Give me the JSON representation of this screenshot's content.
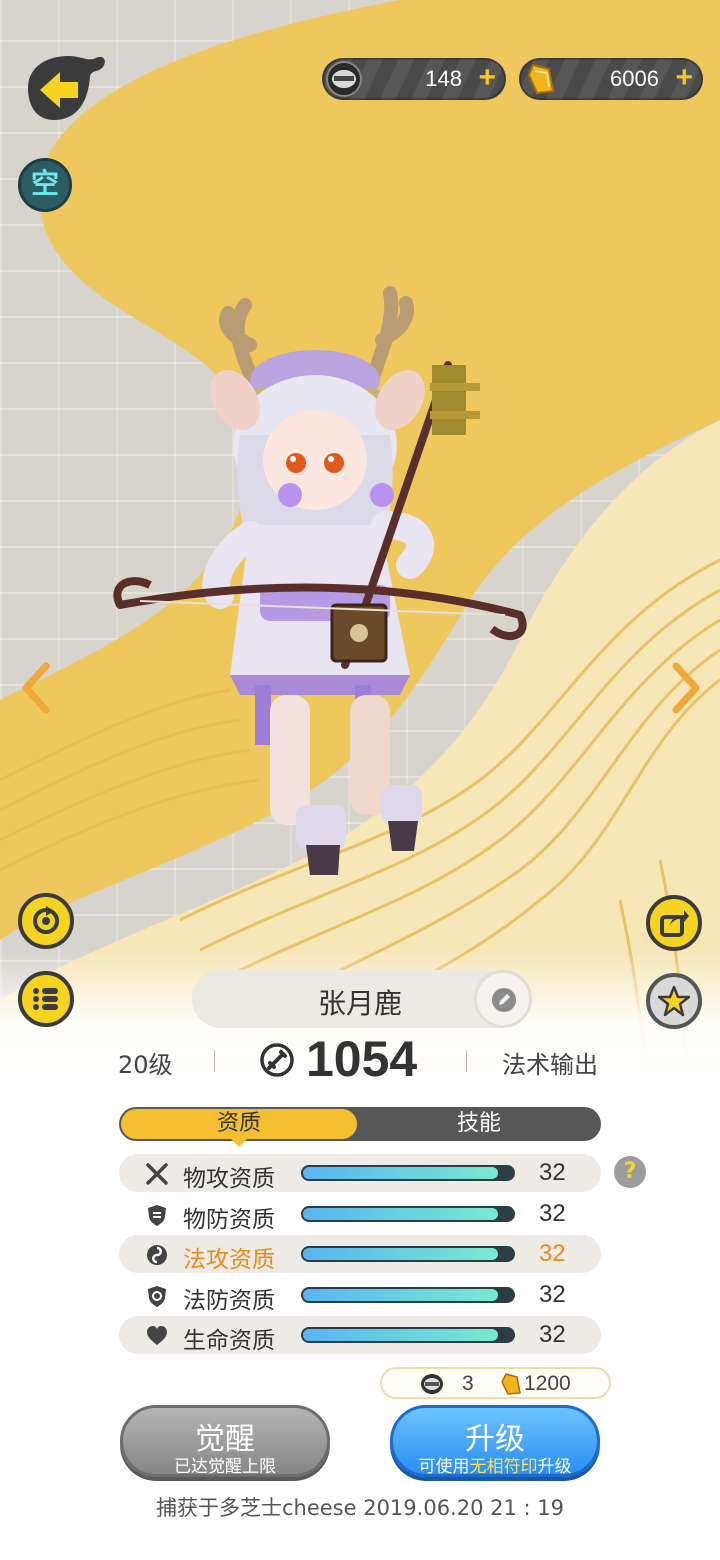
{
  "currencies": [
    {
      "icon": "spirit-coin-icon",
      "value": "148",
      "plus": "+"
    },
    {
      "icon": "gold-ingot-icon",
      "value": "6006",
      "plus": "+"
    }
  ],
  "status_badge": "空",
  "pet": {
    "name": "张月鹿",
    "level": "20级",
    "power": "1054",
    "role": "法术输出"
  },
  "tabs": [
    {
      "label": "资质",
      "active": true
    },
    {
      "label": "技能",
      "active": false
    }
  ],
  "attributes": [
    {
      "icon": "crossed-swords-icon",
      "label": "物攻资质",
      "value": "32",
      "fill": 0.93
    },
    {
      "icon": "shield-icon",
      "label": "物防资质",
      "value": "32",
      "fill": 0.93
    },
    {
      "icon": "magic-swirl-icon",
      "label": "法攻资质",
      "value": "32",
      "fill": 0.93,
      "highlight": true
    },
    {
      "icon": "magic-shield-icon",
      "label": "法防资质",
      "value": "32",
      "fill": 0.93
    },
    {
      "icon": "heart-icon",
      "label": "生命资质",
      "value": "32",
      "fill": 0.93
    }
  ],
  "help_label": "?",
  "cost": {
    "token": "3",
    "gold": "1200"
  },
  "buttons": {
    "awaken": {
      "main": "觉醒",
      "sub": "已达觉醒上限"
    },
    "upgrade": {
      "main": "升级",
      "sub_prefix": "可使用",
      "sub_highlight": "无相符印",
      "sub_suffix": "升级"
    }
  },
  "capture_info": "捕获于多芝士cheese  2019.06.20   21 : 19",
  "colors": {
    "accent_yellow": "#f4c032",
    "highlight_orange": "#e98a1a",
    "upgrade_blue": "#2b8df0"
  }
}
